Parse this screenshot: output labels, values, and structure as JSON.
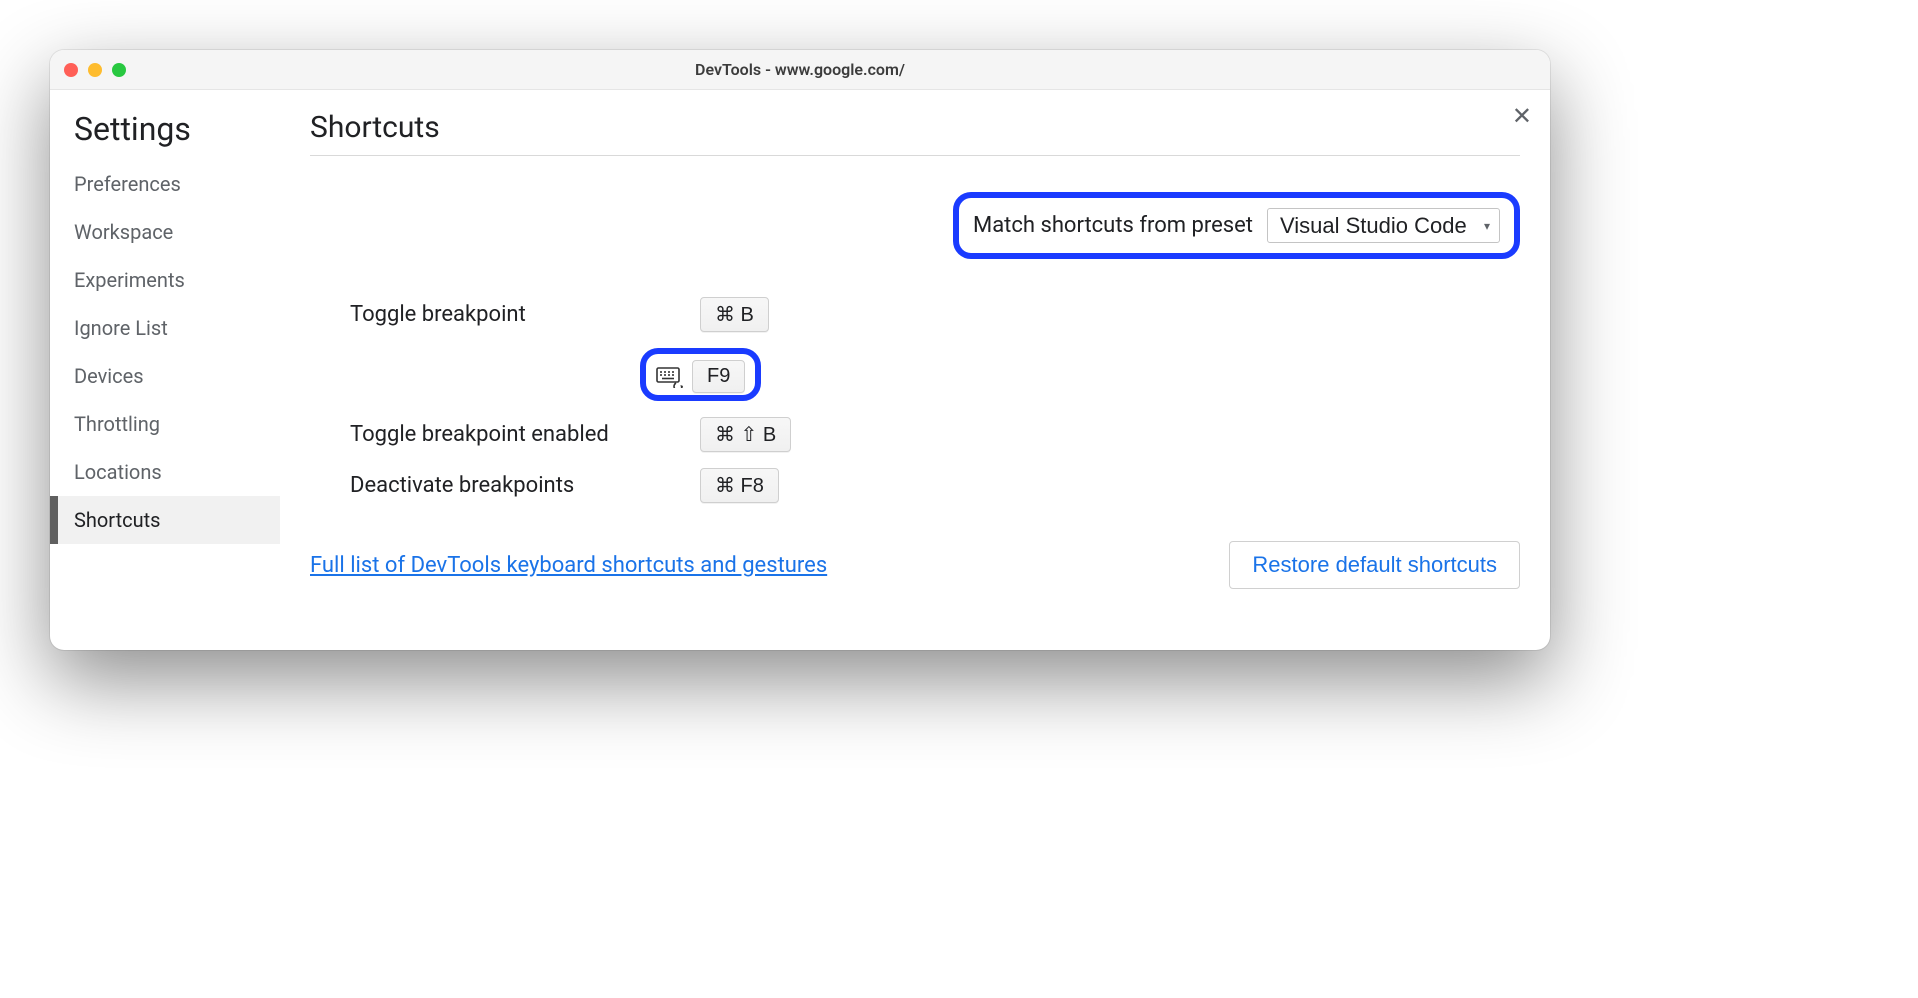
{
  "window": {
    "title": "DevTools - www.google.com/"
  },
  "sidebar": {
    "heading": "Settings",
    "items": [
      {
        "label": "Preferences",
        "active": false
      },
      {
        "label": "Workspace",
        "active": false
      },
      {
        "label": "Experiments",
        "active": false
      },
      {
        "label": "Ignore List",
        "active": false
      },
      {
        "label": "Devices",
        "active": false
      },
      {
        "label": "Throttling",
        "active": false
      },
      {
        "label": "Locations",
        "active": false
      },
      {
        "label": "Shortcuts",
        "active": true
      }
    ]
  },
  "main": {
    "title": "Shortcuts",
    "preset": {
      "label": "Match shortcuts from preset",
      "selected": "Visual Studio Code"
    },
    "shortcuts": [
      {
        "label": "Toggle breakpoint",
        "keys": "⌘ B",
        "extra_key": "F9",
        "extra_highlight": true,
        "extra_icon": "keyboard-icon"
      },
      {
        "label": "Toggle breakpoint enabled",
        "keys": "⌘ ⇧ B"
      },
      {
        "label": "Deactivate breakpoints",
        "keys": "⌘ F8"
      }
    ],
    "link": "Full list of DevTools keyboard shortcuts and gestures",
    "restore_button": "Restore default shortcuts"
  }
}
